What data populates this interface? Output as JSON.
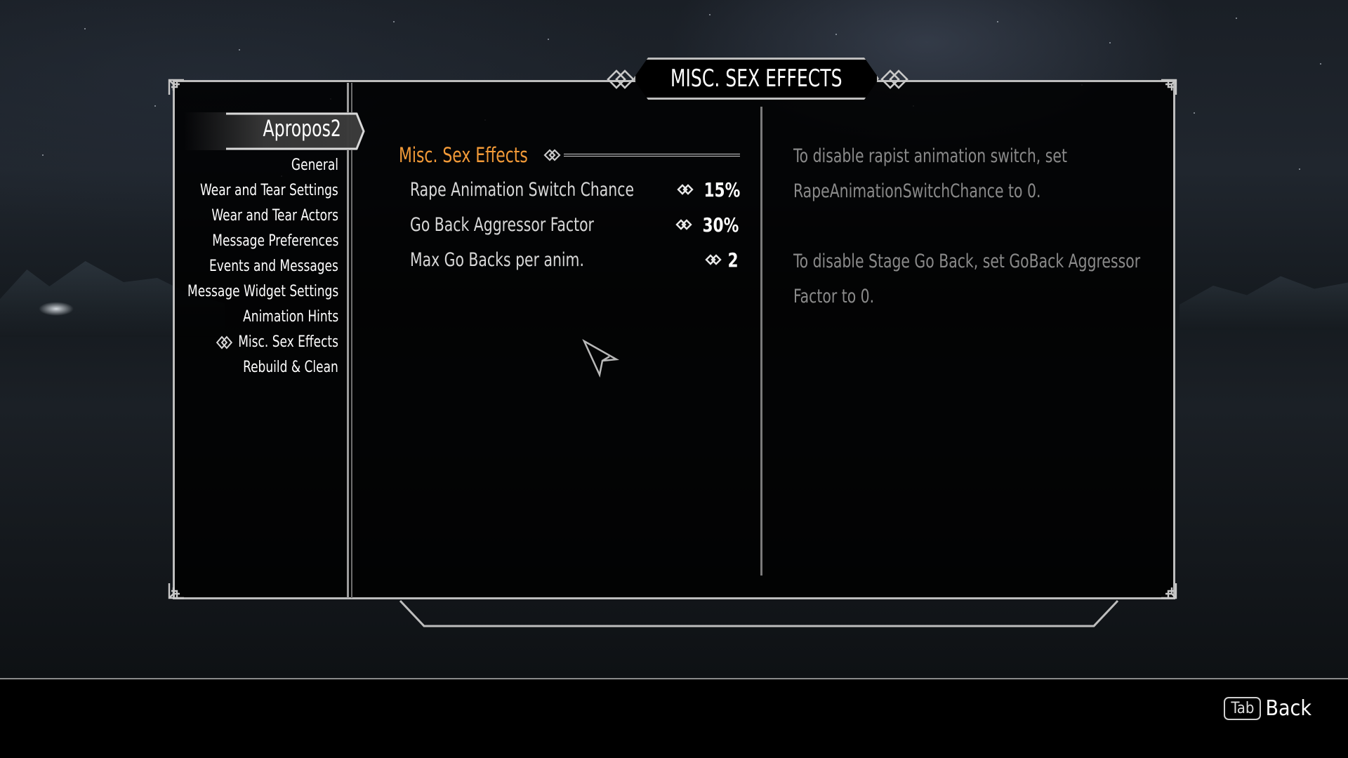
{
  "header": {
    "title": "MISC. SEX EFFECTS"
  },
  "sidebar": {
    "mod_tab": "Apropos2",
    "items": [
      {
        "label": "General",
        "selected": false
      },
      {
        "label": "Wear and Tear Settings",
        "selected": false
      },
      {
        "label": "Wear and Tear Actors",
        "selected": false
      },
      {
        "label": "Message Preferences",
        "selected": false
      },
      {
        "label": "Events and Messages",
        "selected": false
      },
      {
        "label": "Message Widget Settings",
        "selected": false
      },
      {
        "label": "Animation Hints",
        "selected": false
      },
      {
        "label": "Misc. Sex Effects",
        "selected": true
      },
      {
        "label": "Rebuild & Clean",
        "selected": false
      }
    ]
  },
  "content": {
    "section_title": "Misc. Sex Effects",
    "options": [
      {
        "label": "Rape Animation Switch Chance",
        "value": "15%",
        "icon": "slider-arrows-icon"
      },
      {
        "label": "Go Back Aggressor Factor",
        "value": "30%",
        "icon": "slider-arrows-icon"
      },
      {
        "label": "Max Go Backs per anim.",
        "value": "2",
        "icon": "slider-arrows-icon"
      }
    ]
  },
  "info": {
    "paragraphs": [
      "To disable rapist animation switch, set RapeAnimationSwitchChance to 0.",
      "To disable Stage Go Back, set GoBack Aggressor Factor to 0."
    ]
  },
  "footer": {
    "key_label": "Tab",
    "action_label": "Back"
  },
  "colors": {
    "accent": "#f29a38",
    "text": "#ffffff",
    "info_text": "#8a8a8a",
    "frame": "#bdbdbd"
  }
}
